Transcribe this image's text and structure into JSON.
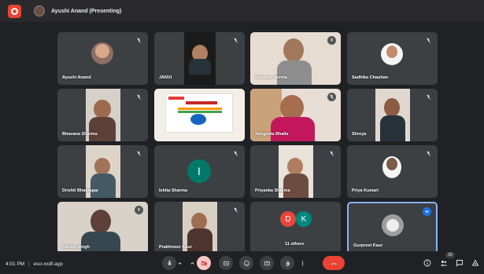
{
  "topbar": {
    "presenter_label": "Ayushi Anand (Presenting)"
  },
  "participants": [
    {
      "name": "Ayushi Anand"
    },
    {
      "name": "JANVI"
    },
    {
      "name": "Vandana Verma"
    },
    {
      "name": "Sadhika Chauhan"
    },
    {
      "name": "Bhavana Sharma"
    },
    {
      "name": ""
    },
    {
      "name": "Sangeeta Bhalla"
    },
    {
      "name": "Shreya"
    },
    {
      "name": "Drishti Bhatnagar"
    },
    {
      "name": "Ishita Sharma",
      "initial": "I"
    },
    {
      "name": "Priyanka Sharma"
    },
    {
      "name": "Priya Kumari"
    },
    {
      "name": "Kanika Singh"
    },
    {
      "name": "Prabhnoor Kaur"
    },
    {
      "name": "11 others",
      "initials": [
        "D",
        "K"
      ]
    },
    {
      "name": "Gurpreet Kaur"
    }
  ],
  "bottombar": {
    "clock": "4:01 PM",
    "separator": "|",
    "meeting_code": "eso-xxdf-ayp",
    "participants_badge": "30"
  },
  "colors": {
    "accent": "#8ab4f8",
    "danger": "#ea4335",
    "tile": "#3c4043",
    "teal": "#00796b"
  },
  "icons": [
    "mic-off-icon",
    "mic-icon",
    "camera-off-icon",
    "captions-icon",
    "emoji-icon",
    "present-icon",
    "hand-icon",
    "more-icon",
    "call-end-icon",
    "info-icon",
    "people-icon",
    "chat-icon",
    "activities-icon"
  ]
}
